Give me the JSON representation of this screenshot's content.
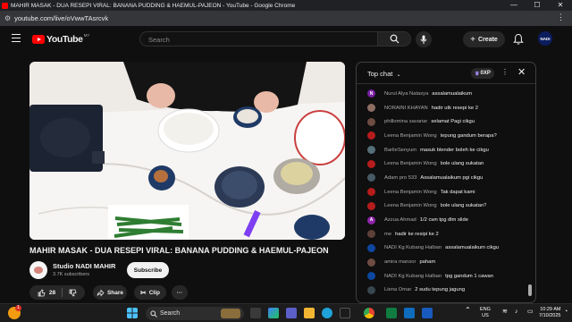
{
  "browser": {
    "window_title": "MAHIR MASAK - DUA RESEPI VIRAL: BANANA PUDDING & HAEMUL-PAJEON - YouTube - Google Chrome",
    "url": "youtube.com/live/oVwwTAsrcvk",
    "controls": {
      "minimize": "—",
      "maximize": "☐",
      "close": "✕"
    }
  },
  "header": {
    "logo_text": "YouTube",
    "country_code": "MY",
    "search_placeholder": "Search",
    "create_label": "Create",
    "avatar_text": "NADI"
  },
  "video": {
    "title": "MAHIR MASAK - DUA RESEPI VIRAL: BANANA PUDDING & HAEMUL-PAJEON",
    "channel_name": "Studio NADI MAHIR",
    "subscribers": "3.7K subscribers",
    "subscribe_label": "Subscribe",
    "likes": "28",
    "share_label": "Share",
    "clip_label": "Clip",
    "more_label": "···"
  },
  "chat": {
    "mode_label": "Top chat",
    "points_label": "0XP",
    "messages": [
      {
        "author": "Nurul Alya Natasya",
        "text": "assalamualaikum",
        "avatar_color": "#7b1fa2",
        "avatar_letter": "N"
      },
      {
        "author": "NORAINI KHAYAN",
        "text": "hadir utk resepi ke 2",
        "avatar_color": "#8d6e63",
        "avatar_letter": ""
      },
      {
        "author": "phillomina savariar",
        "text": "selamat Pagi cikgu",
        "avatar_color": "#6d4c41",
        "avatar_letter": ""
      },
      {
        "author": "Leena Benjamin Wong",
        "text": "tepung gandum berapa?",
        "avatar_color": "#b71c1c",
        "avatar_letter": ""
      },
      {
        "author": "BarlieSenyum",
        "text": "masuk blender boleh ke cikgu",
        "avatar_color": "#546e7a",
        "avatar_letter": ""
      },
      {
        "author": "Leena Benjamin Wong",
        "text": "bole ulang sukatan",
        "avatar_color": "#b71c1c",
        "avatar_letter": ""
      },
      {
        "author": "Adam pro 533",
        "text": "Assalamualaikum pgi cikgu",
        "avatar_color": "#455a64",
        "avatar_letter": ""
      },
      {
        "author": "Leena Benjamin Wong",
        "text": "Tak dapat kami",
        "avatar_color": "#b71c1c",
        "avatar_letter": ""
      },
      {
        "author": "Leena Benjamin Wong",
        "text": "bole ulang sukatan?",
        "avatar_color": "#b71c1c",
        "avatar_letter": ""
      },
      {
        "author": "Azzua Ahmad",
        "text": "1/2 cwn tpg dlm slide",
        "avatar_color": "#8e24aa",
        "avatar_letter": "A"
      },
      {
        "author": "me",
        "text": "hadir ke resipi ke 2",
        "avatar_color": "#5d4037",
        "avatar_letter": ""
      },
      {
        "author": "NADI Kg Kubang Halban",
        "text": "assalamualaikum cikgu",
        "avatar_color": "#0d47a1",
        "avatar_letter": ""
      },
      {
        "author": "amira mansor",
        "text": "paham",
        "avatar_color": "#6d4c41",
        "avatar_letter": ""
      },
      {
        "author": "NADI Kg Kubang Halban",
        "text": "tpg gandum 1 cawan",
        "avatar_color": "#0d47a1",
        "avatar_letter": ""
      },
      {
        "author": "Liena Omar",
        "text": "2 sudu tepung jagung",
        "avatar_color": "#37474f",
        "avatar_letter": ""
      }
    ]
  },
  "taskbar": {
    "search_label": "Search",
    "language_top": "ENG",
    "language_bottom": "US",
    "time": "10:29 AM",
    "date": "7/10/2025",
    "notification_badge": "1"
  }
}
